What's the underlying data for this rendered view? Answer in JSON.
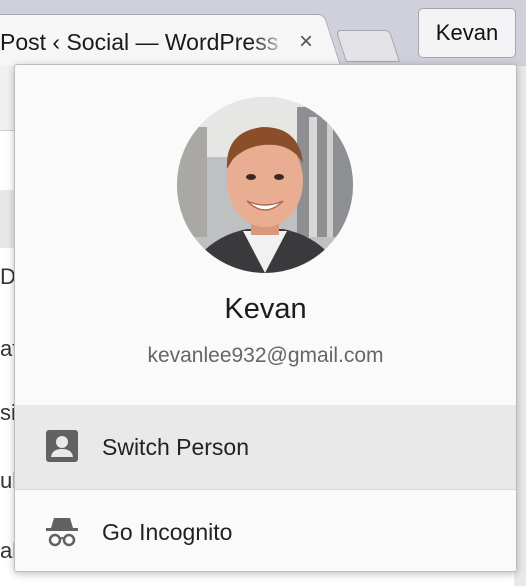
{
  "tab": {
    "title": "Post ‹ Social — WordPress",
    "close_glyph": "×"
  },
  "profile_button": {
    "label": "Kevan"
  },
  "page_behind": {
    "letters": [
      "D",
      "at",
      "sil",
      "ub",
      "al"
    ]
  },
  "popup": {
    "user_name": "Kevan",
    "email": "kevanlee932@gmail.com",
    "avatar_icon": "user-avatar-photo",
    "menu": [
      {
        "label": "Switch Person",
        "icon": "person-icon"
      },
      {
        "label": "Go Incognito",
        "icon": "incognito-icon"
      }
    ]
  },
  "colors": {
    "menu_highlight": "#e9e9e9",
    "icon_gray": "#616161"
  }
}
